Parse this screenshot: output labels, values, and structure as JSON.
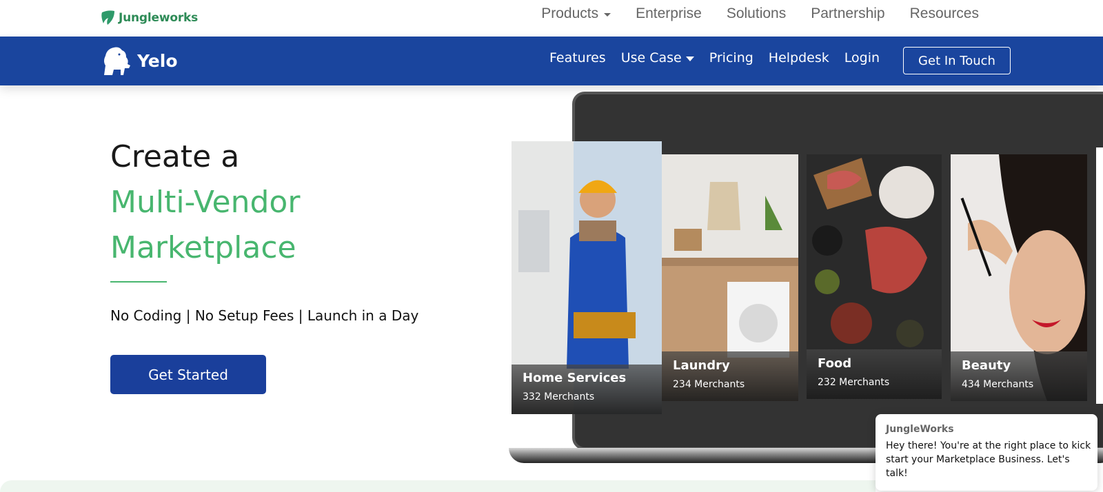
{
  "jungleworks": {
    "logo_text": "Jungleworks",
    "nav": [
      "Products",
      "Enterprise",
      "Solutions",
      "Partnership",
      "Resources"
    ]
  },
  "yelo": {
    "name": "Yelo",
    "nav": [
      "Features",
      "Use Case",
      "Pricing",
      "Helpdesk",
      "Login"
    ],
    "cta": "Get In Touch"
  },
  "hero": {
    "line1": "Create a",
    "line2": "Multi-Vendor",
    "line3": "Marketplace",
    "subtitle": "No Coding | No Setup Fees | Launch in a Day",
    "button": "Get Started"
  },
  "cards": [
    {
      "title": "Home Services",
      "count": "332 Merchants"
    },
    {
      "title": "Laundry",
      "count": "234 Merchants"
    },
    {
      "title": "Food",
      "count": "232 Merchants"
    },
    {
      "title": "Beauty",
      "count": "434 Merchants"
    }
  ],
  "chat": {
    "sender": "JungleWorks",
    "message": "Hey there! You're at the right place to kick start your Marketplace Business. Let's talk!"
  },
  "colors": {
    "brand_blue": "#1a459e",
    "accent_green": "#48b66f"
  }
}
